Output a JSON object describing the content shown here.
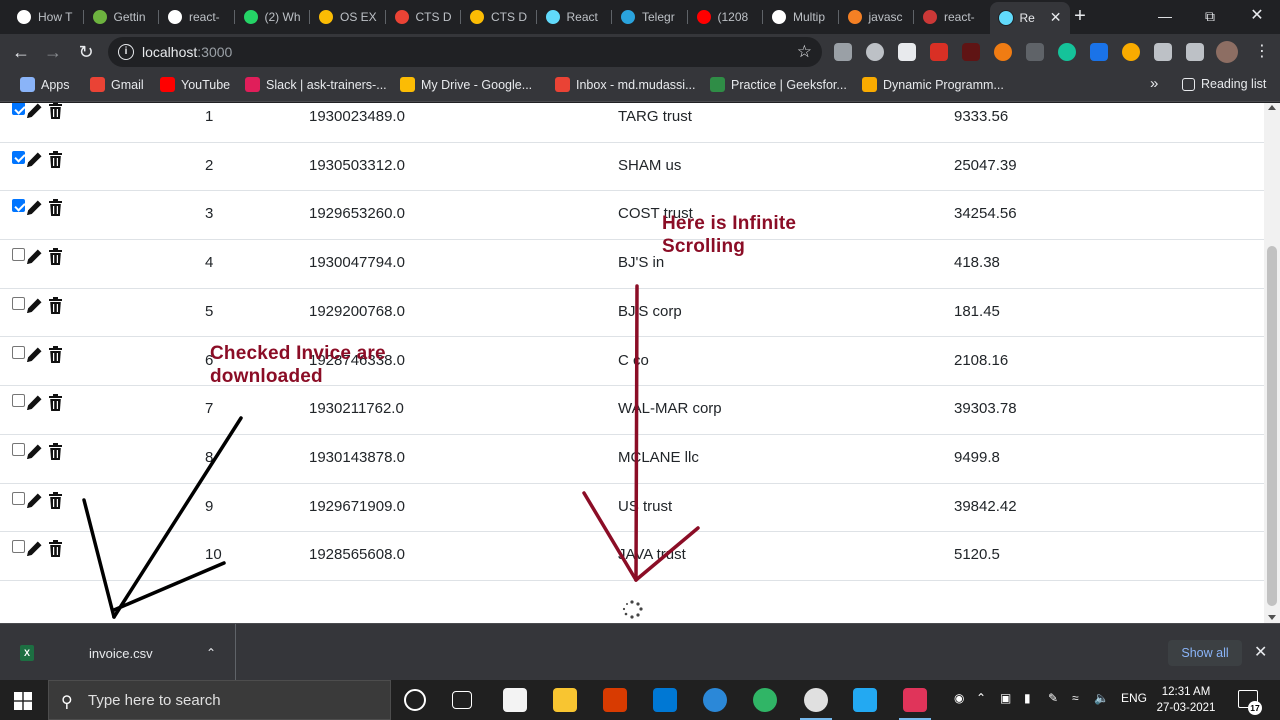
{
  "browser": {
    "tabs": [
      {
        "label": "How T",
        "icon": "medium-icon",
        "color": "#ffffff"
      },
      {
        "label": "Gettin",
        "icon": "spring-icon",
        "color": "#6db33f"
      },
      {
        "label": "react-",
        "icon": "github-icon",
        "color": "#ffffff"
      },
      {
        "label": "(2) Wh",
        "icon": "whatsapp-icon",
        "color": "#25d366"
      },
      {
        "label": "OS EX",
        "icon": "google-drive-icon",
        "color": "#fbbc04"
      },
      {
        "label": "CTS D",
        "icon": "gmail-icon",
        "color": "#ea4335"
      },
      {
        "label": "CTS D",
        "icon": "google-drive-icon",
        "color": "#fbbc04"
      },
      {
        "label": "React",
        "icon": "react-icon",
        "color": "#61dafb"
      },
      {
        "label": "Telegr",
        "icon": "telegram-icon",
        "color": "#2aa3dd"
      },
      {
        "label": "(1208",
        "icon": "youtube-icon",
        "color": "#ff0000"
      },
      {
        "label": "Multip",
        "icon": "medium-icon",
        "color": "#ffffff"
      },
      {
        "label": "javasc",
        "icon": "stackoverflow-icon",
        "color": "#f48024"
      },
      {
        "label": "react-",
        "icon": "npm-icon",
        "color": "#cb3837"
      },
      {
        "label": "Re",
        "icon": "react-icon",
        "color": "#61dafb",
        "active": true
      }
    ],
    "url_host": "localhost",
    "url_port": ":3000",
    "bookmarks": [
      {
        "label": "Apps",
        "color": "#8ab4f8"
      },
      {
        "label": "Gmail",
        "color": "#ea4335"
      },
      {
        "label": "YouTube",
        "color": "#ff0000"
      },
      {
        "label": "Slack | ask-trainers-...",
        "color": "#e01e5a"
      },
      {
        "label": "My Drive - Google...",
        "color": "#fbbc04"
      },
      {
        "label": "Inbox - md.mudassi...",
        "color": "#ea4335"
      },
      {
        "label": "Practice | Geeksfor...",
        "color": "#2f8d46"
      },
      {
        "label": "Dynamic Programm...",
        "color": "#f9ab00"
      }
    ],
    "bookmarks_overflow": "»",
    "reading_list": "Reading list"
  },
  "table": {
    "rows": [
      {
        "checked": true,
        "sl": "1",
        "invoice": "1930023489.0",
        "customer": "TARG trust",
        "amount": "9333.56"
      },
      {
        "checked": true,
        "sl": "2",
        "invoice": "1930503312.0",
        "customer": "SHAM us",
        "amount": "25047.39"
      },
      {
        "checked": true,
        "sl": "3",
        "invoice": "1929653260.0",
        "customer": "COST trust",
        "amount": "34254.56"
      },
      {
        "checked": false,
        "sl": "4",
        "invoice": "1930047794.0",
        "customer": "BJ'S in",
        "amount": "418.38"
      },
      {
        "checked": false,
        "sl": "5",
        "invoice": "1929200768.0",
        "customer": "BJ'S corp",
        "amount": "181.45"
      },
      {
        "checked": false,
        "sl": "6",
        "invoice": "1928746338.0",
        "customer": "C co",
        "amount": "2108.16"
      },
      {
        "checked": false,
        "sl": "7",
        "invoice": "1930211762.0",
        "customer": "WAL-MAR corp",
        "amount": "39303.78"
      },
      {
        "checked": false,
        "sl": "8",
        "invoice": "1930143878.0",
        "customer": "MCLANE llc",
        "amount": "9499.8"
      },
      {
        "checked": false,
        "sl": "9",
        "invoice": "1929671909.0",
        "customer": "US trust",
        "amount": "39842.42"
      },
      {
        "checked": false,
        "sl": "10",
        "invoice": "1928565608.0",
        "customer": "JAVA trust",
        "amount": "5120.5"
      }
    ]
  },
  "annotations": {
    "infinite_line1": "Here is Infinite",
    "infinite_line2": "Scrolling",
    "checked_line1": "Checked Invice are",
    "checked_line2": "downloaded",
    "arrow_color_dark_red": "#8b0d26",
    "arrow_color_black": "#000000"
  },
  "downloads": {
    "file_name": "invoice.csv",
    "show_all": "Show all"
  },
  "taskbar": {
    "search_placeholder": "Type here to search",
    "language": "ENG",
    "time": "12:31 AM",
    "date": "27-03-2021",
    "notifications": "17"
  }
}
